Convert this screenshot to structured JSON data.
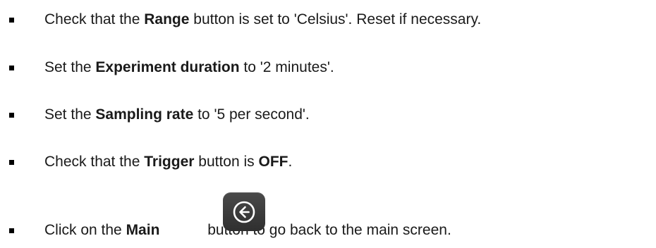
{
  "instructions": [
    {
      "pre": "Check that the ",
      "bold": "Range",
      "post": " button is set to 'Celsius'. Reset if necessary."
    },
    {
      "pre": "Set the ",
      "bold": "Experiment duration",
      "post": " to '2 minutes'."
    },
    {
      "pre": "Set the ",
      "bold": "Sampling rate",
      "post": " to '5 per second'."
    },
    {
      "pre": "Check that the ",
      "bold": "Trigger",
      "mid": " button is ",
      "bold2": "OFF",
      "post": "."
    },
    {
      "pre": "Click on the ",
      "bold": "Main",
      "post": " button to go back to the main screen.",
      "icon": "back-arrow-circle-icon"
    }
  ],
  "colors": {
    "text": "#1a1a1a",
    "icon_button_bg": "#3a3a3a",
    "icon_fg": "#ffffff"
  }
}
